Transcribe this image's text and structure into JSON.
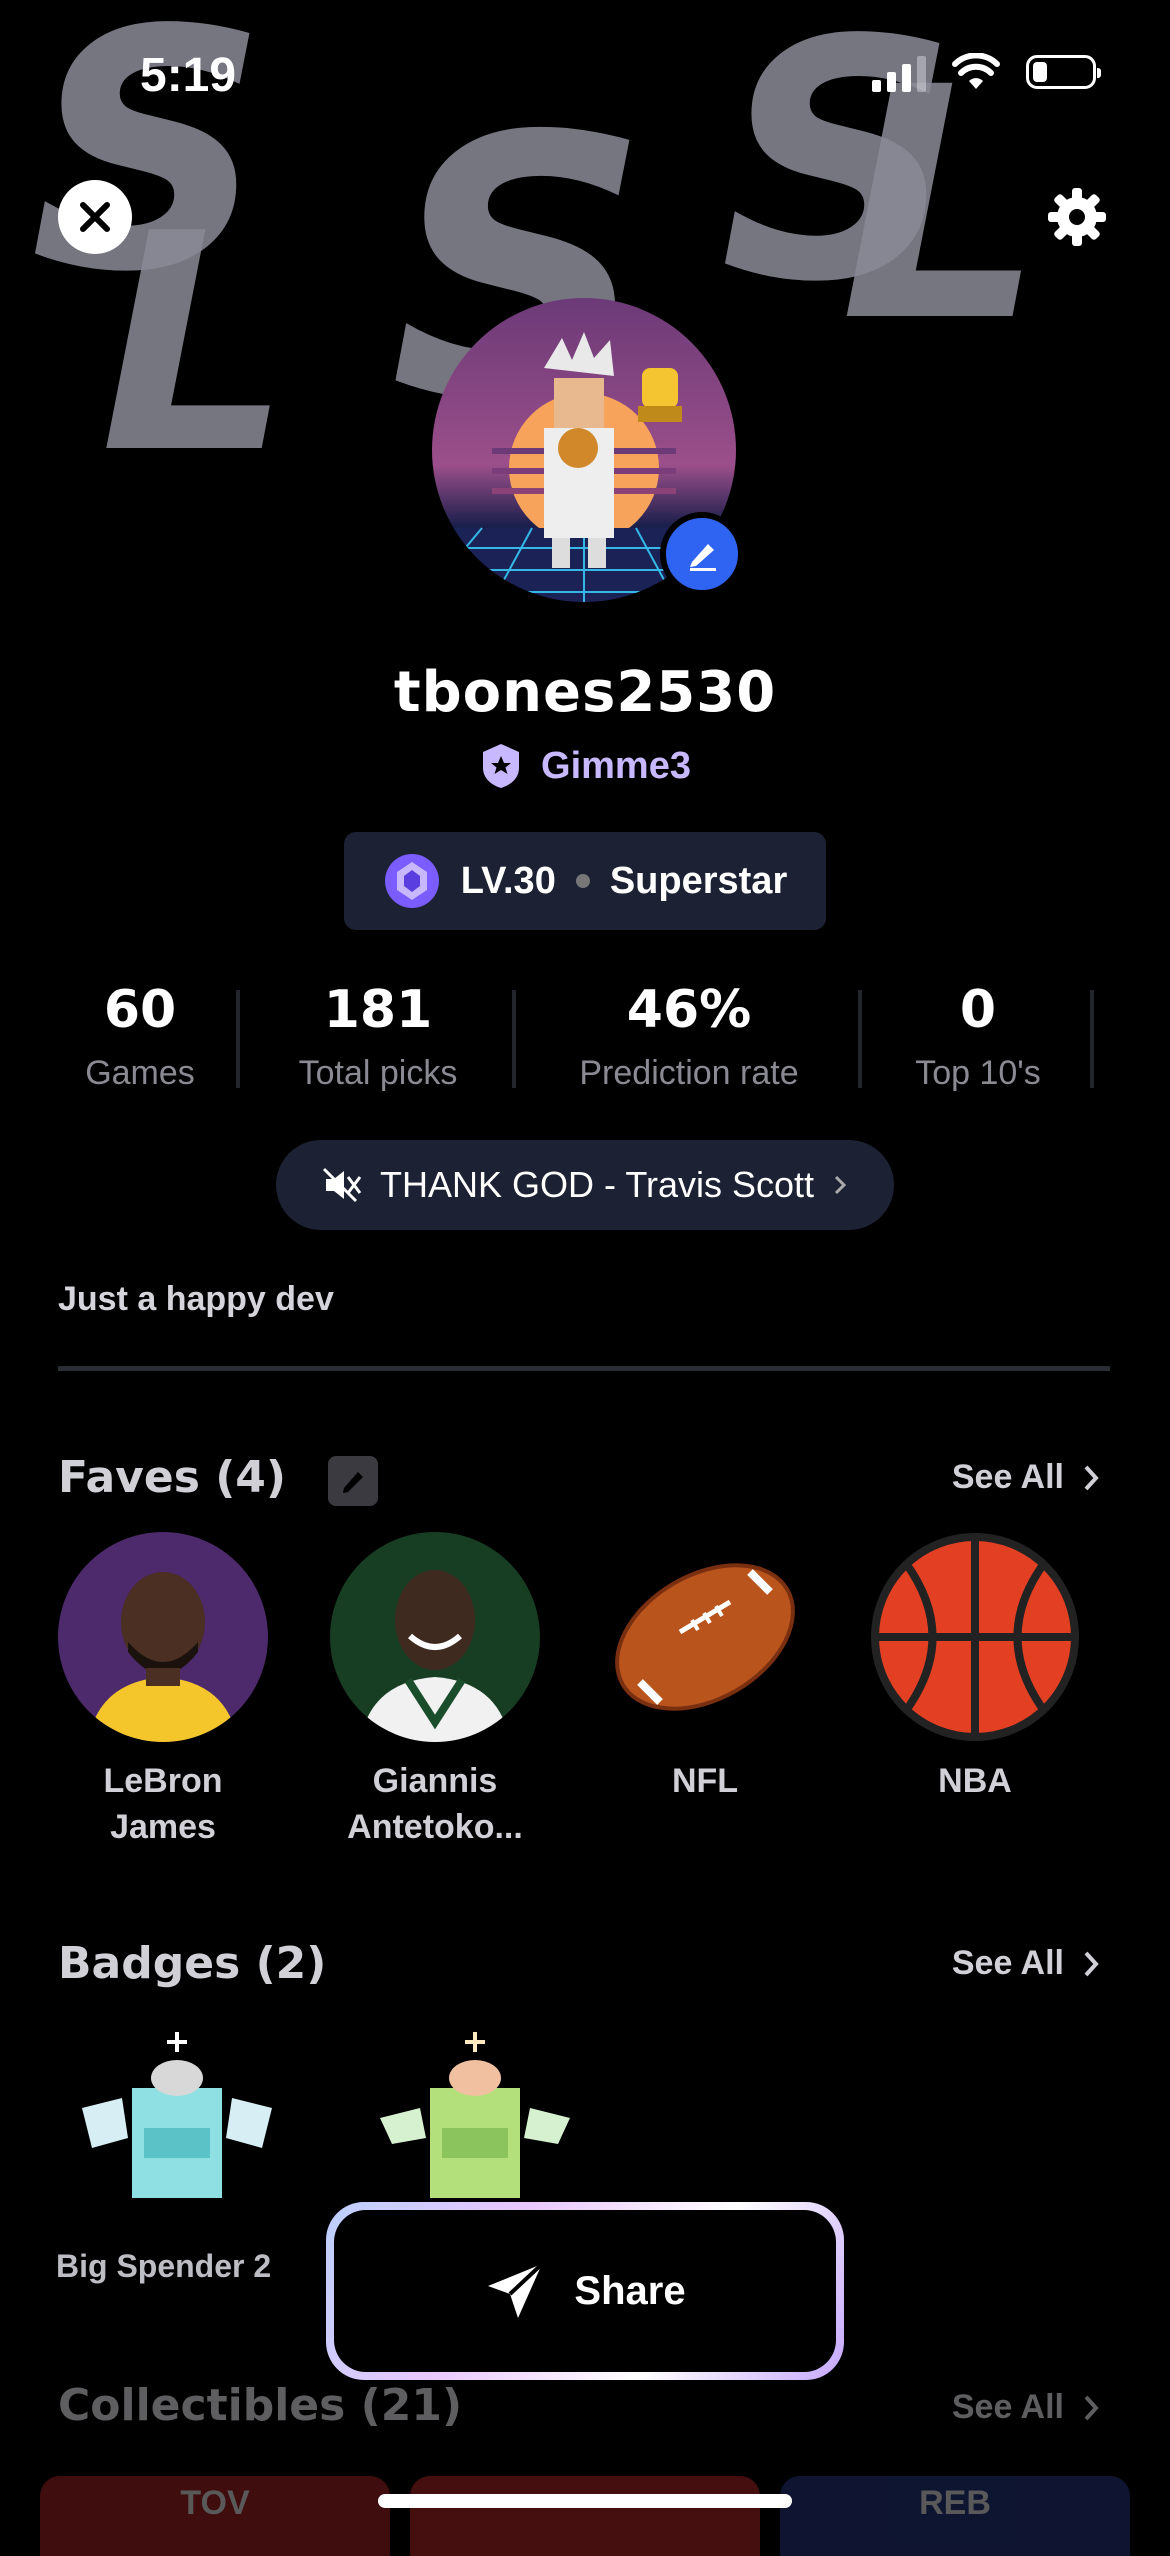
{
  "status_bar": {
    "time": "5:19"
  },
  "profile": {
    "username": "tbones2530",
    "team": "Gimme3",
    "level": "LV.30",
    "rank": "Superstar",
    "bio": "Just a happy dev"
  },
  "stats": [
    {
      "value": "60",
      "label": "Games"
    },
    {
      "value": "181",
      "label": "Total picks"
    },
    {
      "value": "46%",
      "label": "Prediction rate"
    },
    {
      "value": "0",
      "label": "Top 10's"
    }
  ],
  "music": {
    "track": "THANK GOD - Travis Scott",
    "muted": true
  },
  "faves": {
    "title": "Faves (4)",
    "see_all": "See All",
    "items": [
      {
        "name": "LeBron James"
      },
      {
        "name": "Giannis Antetoko..."
      },
      {
        "name": "NFL"
      },
      {
        "name": "NBA"
      }
    ]
  },
  "badges": {
    "title": "Badges (2)",
    "see_all": "See All",
    "items": [
      {
        "name": "Big Spender 2"
      }
    ]
  },
  "collectibles": {
    "title": "Collectibles (21)",
    "see_all": "See All",
    "cards": [
      "TOV",
      "",
      "REB"
    ]
  },
  "share": {
    "label": "Share"
  }
}
